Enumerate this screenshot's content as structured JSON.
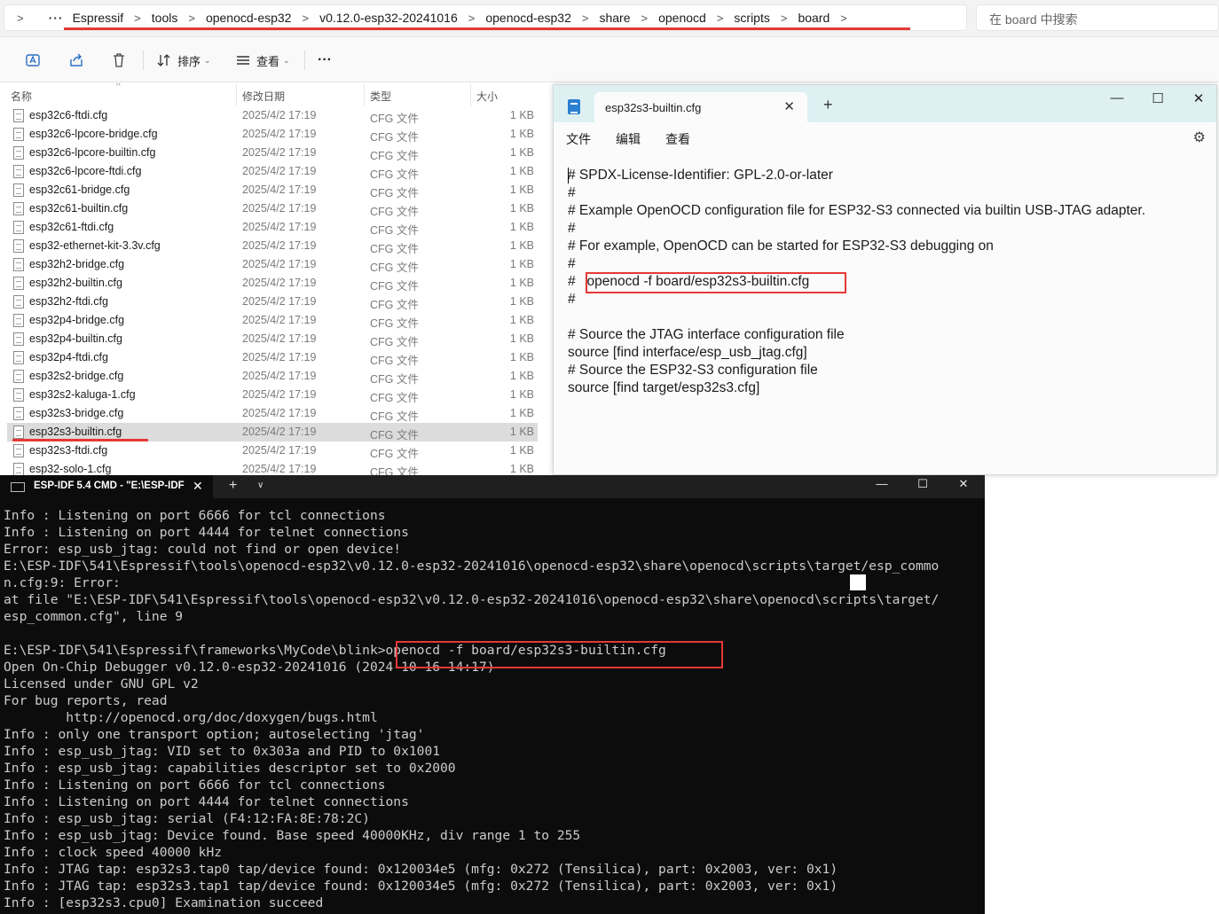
{
  "explorer": {
    "breadcrumb": [
      "Espressif",
      "tools",
      "openocd-esp32",
      "v0.12.0-esp32-20241016",
      "openocd-esp32",
      "share",
      "openocd",
      "scripts",
      "board"
    ],
    "search_placeholder": "在 board 中搜索",
    "toolbar": {
      "sort_label": "排序",
      "view_label": "查看",
      "more_label": "···"
    },
    "columns": {
      "name": "名称",
      "date": "修改日期",
      "type": "类型",
      "size": "大小"
    },
    "files": [
      {
        "name": "esp32c6-ftdi.cfg",
        "date": "2025/4/2 17:19",
        "type": "CFG 文件",
        "size": "1 KB"
      },
      {
        "name": "esp32c6-lpcore-bridge.cfg",
        "date": "2025/4/2 17:19",
        "type": "CFG 文件",
        "size": "1 KB"
      },
      {
        "name": "esp32c6-lpcore-builtin.cfg",
        "date": "2025/4/2 17:19",
        "type": "CFG 文件",
        "size": "1 KB"
      },
      {
        "name": "esp32c6-lpcore-ftdi.cfg",
        "date": "2025/4/2 17:19",
        "type": "CFG 文件",
        "size": "1 KB"
      },
      {
        "name": "esp32c61-bridge.cfg",
        "date": "2025/4/2 17:19",
        "type": "CFG 文件",
        "size": "1 KB"
      },
      {
        "name": "esp32c61-builtin.cfg",
        "date": "2025/4/2 17:19",
        "type": "CFG 文件",
        "size": "1 KB"
      },
      {
        "name": "esp32c61-ftdi.cfg",
        "date": "2025/4/2 17:19",
        "type": "CFG 文件",
        "size": "1 KB"
      },
      {
        "name": "esp32-ethernet-kit-3.3v.cfg",
        "date": "2025/4/2 17:19",
        "type": "CFG 文件",
        "size": "1 KB"
      },
      {
        "name": "esp32h2-bridge.cfg",
        "date": "2025/4/2 17:19",
        "type": "CFG 文件",
        "size": "1 KB"
      },
      {
        "name": "esp32h2-builtin.cfg",
        "date": "2025/4/2 17:19",
        "type": "CFG 文件",
        "size": "1 KB"
      },
      {
        "name": "esp32h2-ftdi.cfg",
        "date": "2025/4/2 17:19",
        "type": "CFG 文件",
        "size": "1 KB"
      },
      {
        "name": "esp32p4-bridge.cfg",
        "date": "2025/4/2 17:19",
        "type": "CFG 文件",
        "size": "1 KB"
      },
      {
        "name": "esp32p4-builtin.cfg",
        "date": "2025/4/2 17:19",
        "type": "CFG 文件",
        "size": "1 KB"
      },
      {
        "name": "esp32p4-ftdi.cfg",
        "date": "2025/4/2 17:19",
        "type": "CFG 文件",
        "size": "1 KB"
      },
      {
        "name": "esp32s2-bridge.cfg",
        "date": "2025/4/2 17:19",
        "type": "CFG 文件",
        "size": "1 KB"
      },
      {
        "name": "esp32s2-kaluga-1.cfg",
        "date": "2025/4/2 17:19",
        "type": "CFG 文件",
        "size": "1 KB"
      },
      {
        "name": "esp32s3-bridge.cfg",
        "date": "2025/4/2 17:19",
        "type": "CFG 文件",
        "size": "1 KB"
      },
      {
        "name": "esp32s3-builtin.cfg",
        "date": "2025/4/2 17:19",
        "type": "CFG 文件",
        "size": "1 KB",
        "selected": true
      },
      {
        "name": "esp32s3-ftdi.cfg",
        "date": "2025/4/2 17:19",
        "type": "CFG 文件",
        "size": "1 KB"
      },
      {
        "name": "esp32-solo-1.cfg",
        "date": "2025/4/2 17:19",
        "type": "CFG 文件",
        "size": "1 KB"
      }
    ]
  },
  "notepad": {
    "tab_title": "esp32s3-builtin.cfg",
    "menu": {
      "file": "文件",
      "edit": "编辑",
      "view": "查看"
    },
    "lines": [
      "# SPDX-License-Identifier: GPL-2.0-or-later",
      "#",
      "# Example OpenOCD configuration file for ESP32-S3 connected via builtin USB-JTAG adapter.",
      "#",
      "# For example, OpenOCD can be started for ESP32-S3 debugging on",
      "#",
      "#   openocd -f board/esp32s3-builtin.cfg",
      "#",
      "",
      "# Source the JTAG interface configuration file",
      "source [find interface/esp_usb_jtag.cfg]",
      "# Source the ESP32-S3 configuration file",
      "source [find target/esp32s3.cfg]"
    ]
  },
  "terminal": {
    "tab_title": "ESP-IDF 5.4 CMD - \"E:\\ESP-IDF",
    "lines": [
      "Info : Listening on port 6666 for tcl connections",
      "Info : Listening on port 4444 for telnet connections",
      "Error: esp_usb_jtag: could not find or open device!",
      "E:\\ESP-IDF\\541\\Espressif\\tools\\openocd-esp32\\v0.12.0-esp32-20241016\\openocd-esp32\\share\\openocd\\scripts\\target/esp_commo",
      "n.cfg:9: Error:",
      "at file \"E:\\ESP-IDF\\541\\Espressif\\tools\\openocd-esp32\\v0.12.0-esp32-20241016\\openocd-esp32\\share\\openocd\\scripts\\target/",
      "esp_common.cfg\", line 9",
      "",
      "E:\\ESP-IDF\\541\\Espressif\\frameworks\\MyCode\\blink>openocd -f board/esp32s3-builtin.cfg",
      "Open On-Chip Debugger v0.12.0-esp32-20241016 (2024-10-16-14:17)",
      "Licensed under GNU GPL v2",
      "For bug reports, read",
      "        http://openocd.org/doc/doxygen/bugs.html",
      "Info : only one transport option; autoselecting 'jtag'",
      "Info : esp_usb_jtag: VID set to 0x303a and PID to 0x1001",
      "Info : esp_usb_jtag: capabilities descriptor set to 0x2000",
      "Info : Listening on port 6666 for tcl connections",
      "Info : Listening on port 4444 for telnet connections",
      "Info : esp_usb_jtag: serial (F4:12:FA:8E:78:2C)",
      "Info : esp_usb_jtag: Device found. Base speed 40000KHz, div range 1 to 255",
      "Info : clock speed 40000 kHz",
      "Info : JTAG tap: esp32s3.tap0 tap/device found: 0x120034e5 (mfg: 0x272 (Tensilica), part: 0x2003, ver: 0x1)",
      "Info : JTAG tap: esp32s3.tap1 tap/device found: 0x120034e5 (mfg: 0x272 (Tensilica), part: 0x2003, ver: 0x1)",
      "Info : [esp32s3.cpu0] Examination succeed"
    ]
  },
  "colors": {
    "highlight_red": "#e53935",
    "terminal_bg": "#0c0c0c",
    "notepad_titlebar": "#dff0f3",
    "selection": "#dcdcdc"
  }
}
